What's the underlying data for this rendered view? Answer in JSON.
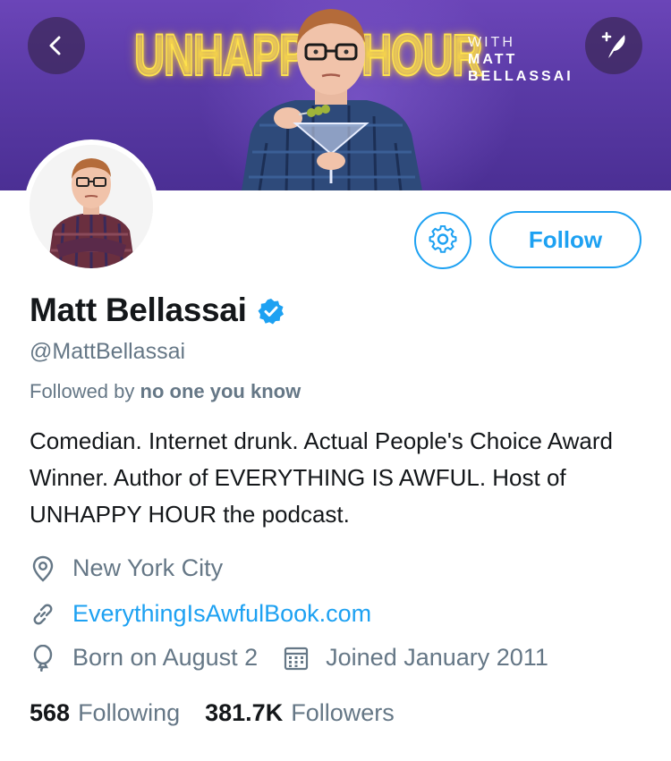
{
  "banner": {
    "title_left": "UNHAPPY",
    "title_right": "HOUR",
    "with_label": "WITH",
    "host_first": "MATT",
    "host_last": "BELLASSAI",
    "accent_color": "#ffe34d",
    "background_color": "#5a3aa6"
  },
  "nav": {
    "back_icon": "back-chevron-icon",
    "compose_icon": "compose-tweet-icon"
  },
  "profile": {
    "name": "Matt Bellassai",
    "verified": true,
    "handle": "@MattBellassai",
    "followed_by_prefix": "Followed by",
    "followed_by_value": "no one you know",
    "bio": "Comedian. Internet drunk. Actual People's Choice Award Winner. Author of EVERYTHING IS AWFUL. Host of UNHAPPY HOUR the podcast.",
    "location": "New York City",
    "website": "EverythingIsAwfulBook.com",
    "birthday": "Born on August 2",
    "joined": "Joined January 2011"
  },
  "actions": {
    "settings_icon": "gear-icon",
    "follow_label": "Follow",
    "accent_color": "#1da1f2"
  },
  "stats": {
    "following_count": "568",
    "following_label": "Following",
    "followers_count": "381.7K",
    "followers_label": "Followers"
  }
}
